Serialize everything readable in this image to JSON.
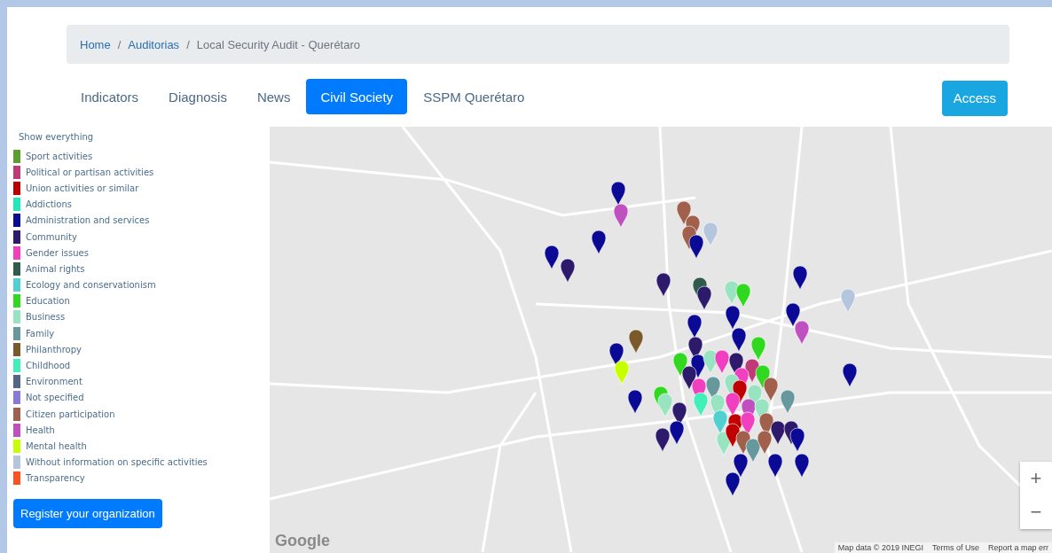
{
  "breadcrumb": [
    {
      "label": "Home",
      "link": true
    },
    {
      "separator": "/"
    },
    {
      "label": "Auditorias",
      "link": true
    },
    {
      "separator": "/"
    },
    {
      "label": "Local Security Audit - Querétaro",
      "link": false
    }
  ],
  "tabs": [
    {
      "label": "Indicators",
      "selected": false
    },
    {
      "label": "Diagnosis",
      "selected": false
    },
    {
      "label": "News",
      "selected": false
    },
    {
      "label": "Civil Society",
      "selected": true
    },
    {
      "label": "SSPM Querétaro",
      "selected": false
    }
  ],
  "access_button": "Access",
  "legend": {
    "show_all": "Show everything",
    "items": [
      {
        "label": "Sport activities",
        "color": "#5a9e2e"
      },
      {
        "label": "Political or partisan activities",
        "color": "#c03a78"
      },
      {
        "label": "Union activities or similar",
        "color": "#c00000"
      },
      {
        "label": "Addictions",
        "color": "#20e8b8"
      },
      {
        "label": "Administration and services",
        "color": "#0a0a96"
      },
      {
        "label": "Community",
        "color": "#2e1a6c"
      },
      {
        "label": "Gender issues",
        "color": "#f040c0"
      },
      {
        "label": "Animal rights",
        "color": "#2f5a4c"
      },
      {
        "label": "Ecology and conservationism",
        "color": "#50d0d0"
      },
      {
        "label": "Education",
        "color": "#30d820"
      },
      {
        "label": "Business",
        "color": "#98e4c0"
      },
      {
        "label": "Family",
        "color": "#66989e"
      },
      {
        "label": "Philanthropy",
        "color": "#7a5a2a"
      },
      {
        "label": "Childhood",
        "color": "#40f0b8"
      },
      {
        "label": "Environment",
        "color": "#546686"
      },
      {
        "label": "Not specified",
        "color": "#8878d8"
      },
      {
        "label": "Citizen participation",
        "color": "#a0604c"
      },
      {
        "label": "Health",
        "color": "#c050c0"
      },
      {
        "label": "Mental health",
        "color": "#c8ff00"
      },
      {
        "label": "Without information on specific activities",
        "color": "#b4c6de"
      },
      {
        "label": "Transparency",
        "color": "#ff5020"
      }
    ]
  },
  "register_button": "Register your organization",
  "map": {
    "logo": "Google",
    "attribution": [
      "Map data © 2019 INEGI",
      "Terms of Use",
      "Report a map err"
    ],
    "zoom_in": "+",
    "zoom_out": "−"
  }
}
